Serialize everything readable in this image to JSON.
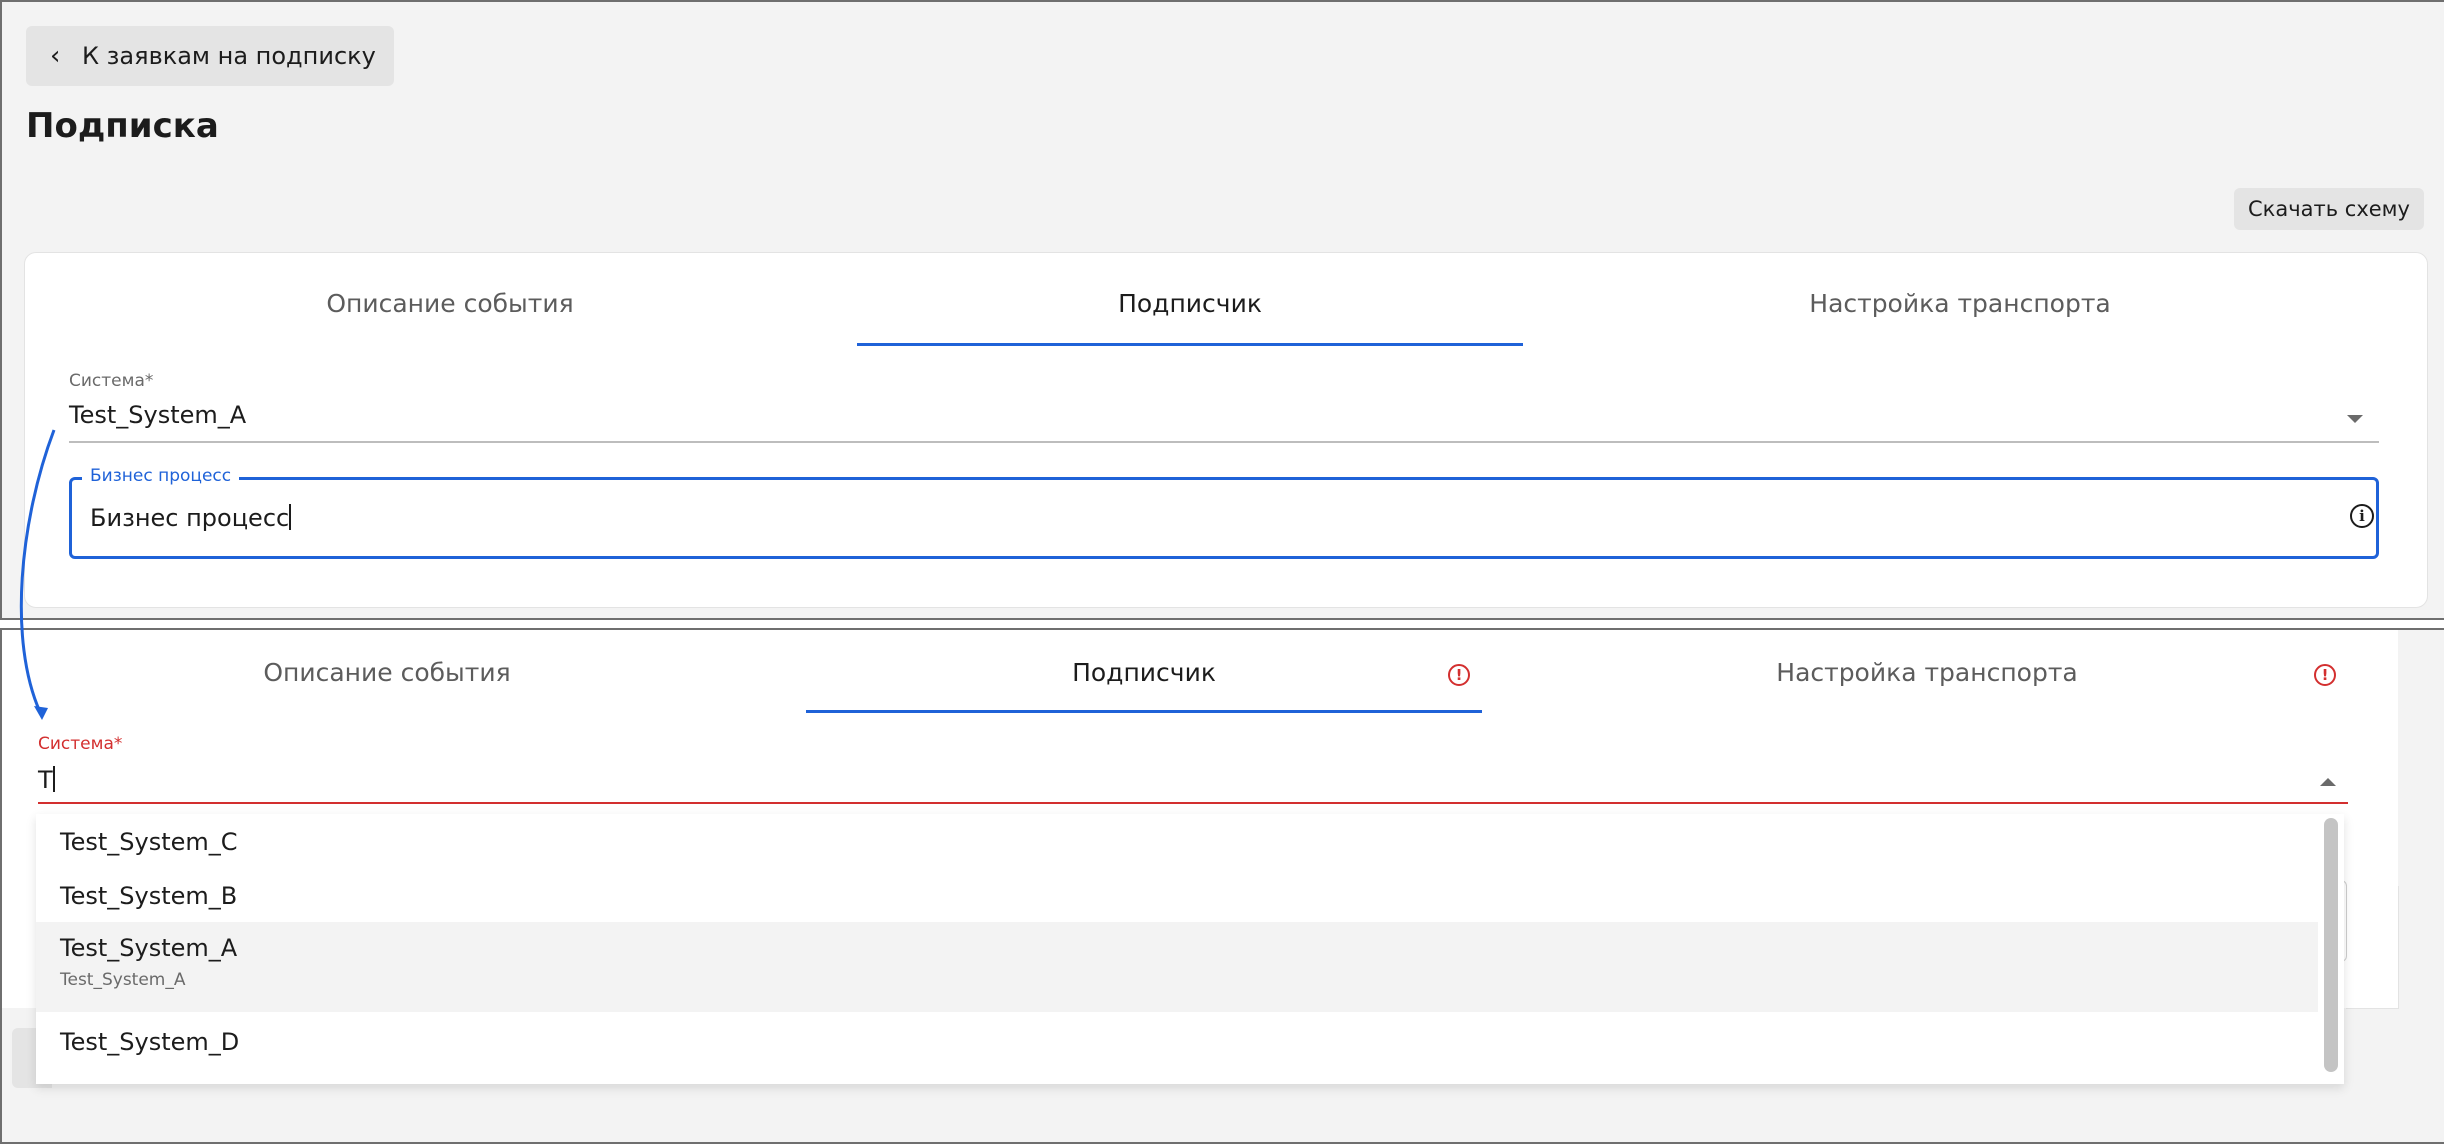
{
  "top": {
    "back_button": "К заявкам на подписку",
    "title": "Подписка",
    "download_button": "Скачать схему",
    "tabs": [
      "Описание события",
      "Подписчик",
      "Настройка транспорта"
    ],
    "system_field": {
      "label": "Система",
      "required": "*",
      "value": "Test_System_A"
    },
    "business_process": {
      "label": "Бизнес процесс",
      "value": "Бизнес процесс"
    }
  },
  "bottom": {
    "tabs": [
      "Описание события",
      "Подписчик",
      "Настройка транспорта"
    ],
    "system_field": {
      "label": "Система",
      "required": "*",
      "value": "T"
    },
    "options": [
      {
        "label": "Test_System_C"
      },
      {
        "label": "Test_System_B"
      },
      {
        "label": "Test_System_A",
        "sub": "Test_System_A"
      },
      {
        "label": "Test_System_D"
      }
    ]
  },
  "colors": {
    "accent": "#1f62d8",
    "error": "#d32f2f",
    "panel_bg": "#f3f3f3"
  },
  "icons": [
    "chevron-left-icon",
    "dropdown-arrow-icon",
    "info-icon",
    "error-icon"
  ]
}
